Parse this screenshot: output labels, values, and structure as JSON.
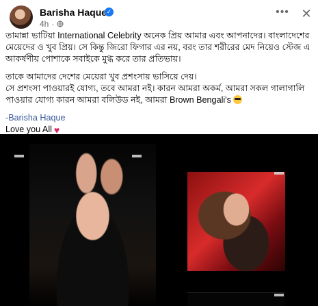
{
  "post": {
    "author": "Barisha Haque",
    "time": "4h",
    "menu_icon": "more-horizontal-icon",
    "close_icon": "close-icon",
    "text": {
      "line1": "তামান্না ভাটিয়া International Celebrity অনেক প্রিয় আমার এবং আপনাদের। বাংলাদেশের মেয়েদের ও খুব প্রিয়। সে কিন্তু জিরো ফিগার এর নয়, বরং তার শরীরের মেদ নিয়েও স্টেজ এ আকর্ষণীয় পোশাকে সবাইকে মুগ্ধ করে তার প্রতিভায়।",
      "line2": "তাকে আমাদের দেশের মেয়েরা খুব প্রশংসায় ভাসিয়ে দেয়।",
      "line3": "সে প্রশংসা পাওয়ারই যোগ্য, তবে আমরা নই। কারন আমরা অকর্ম, আমরা সকল গালাগালি পাওয়ার যোগ্য কারন আমরা বলিউড নই, আমরা Brown Bengali's",
      "signature": "-Barisha Haque",
      "closing": "Love you All"
    }
  }
}
